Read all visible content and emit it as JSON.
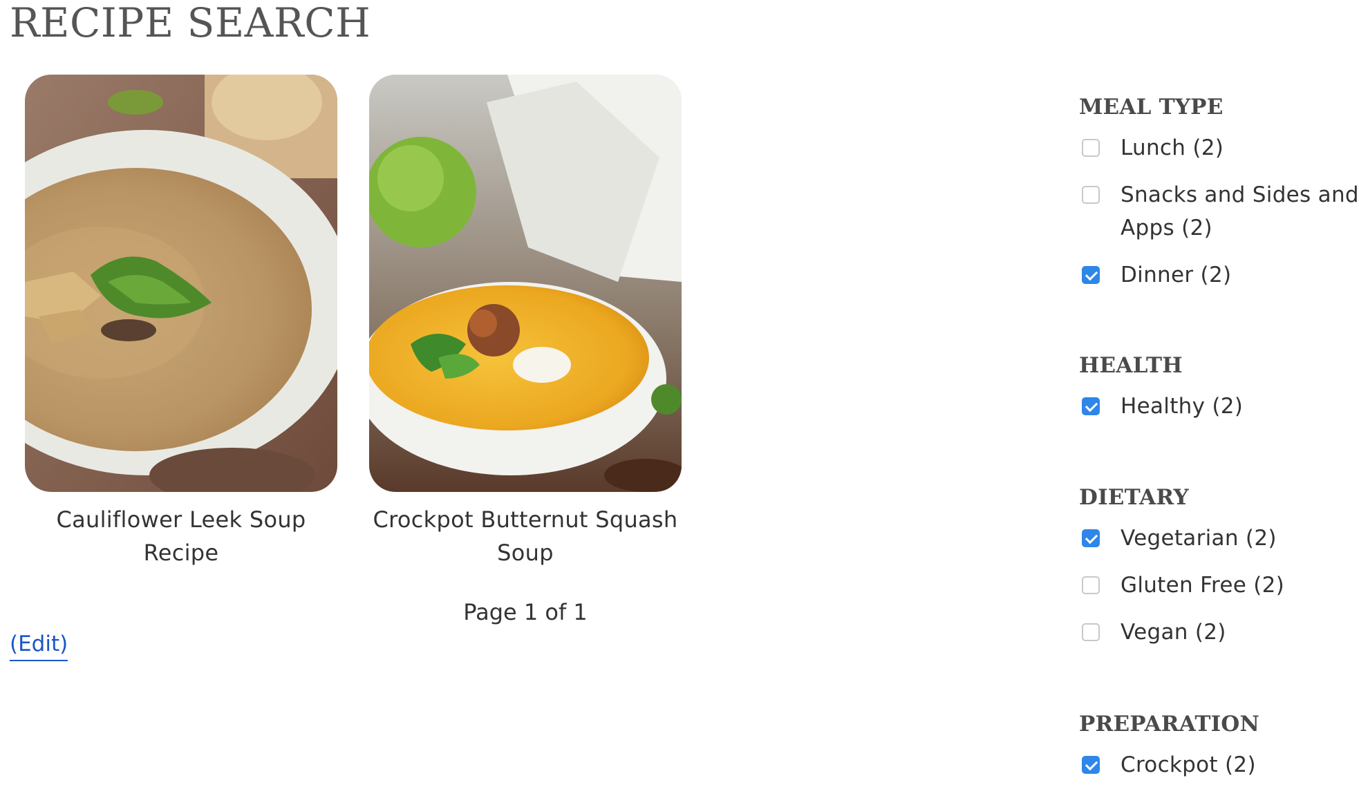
{
  "page": {
    "title": "RECIPE SEARCH"
  },
  "results": [
    {
      "title": "Cauliflower Leek Soup Recipe",
      "image": "cauliflower-leek-soup-photo"
    },
    {
      "title": "Crockpot Butternut Squash Soup",
      "image": "butternut-squash-soup-photo"
    }
  ],
  "pagination": {
    "label": "Page 1 of 1"
  },
  "edit_link": "(Edit)",
  "facets": [
    {
      "heading": "MEAL TYPE",
      "options": [
        {
          "label": "Lunch (2)",
          "checked": false
        },
        {
          "label": "Snacks and Sides and Apps (2)",
          "checked": false
        },
        {
          "label": "Dinner (2)",
          "checked": true
        }
      ]
    },
    {
      "heading": "HEALTH",
      "options": [
        {
          "label": "Healthy (2)",
          "checked": true
        }
      ]
    },
    {
      "heading": "DIETARY",
      "options": [
        {
          "label": "Vegetarian (2)",
          "checked": true
        },
        {
          "label": "Gluten Free (2)",
          "checked": false
        },
        {
          "label": "Vegan (2)",
          "checked": false
        }
      ]
    },
    {
      "heading": "PREPARATION",
      "options": [
        {
          "label": "Crockpot (2)",
          "checked": true
        }
      ]
    }
  ],
  "colors": {
    "link": "#1a56c8",
    "checkbox_checked": "#2f86e8",
    "heading": "#4a4a4a",
    "text": "#333333"
  }
}
